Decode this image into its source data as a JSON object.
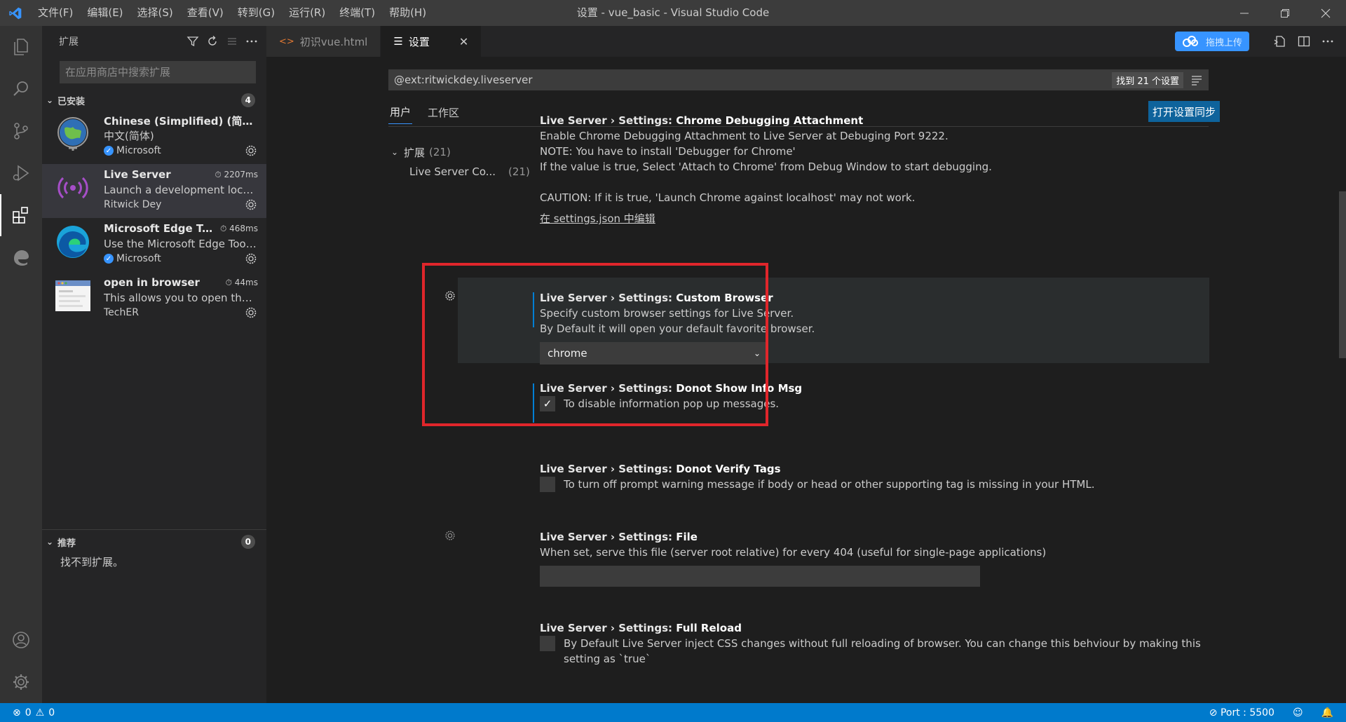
{
  "window": {
    "title": "设置 - vue_basic - Visual Studio Code",
    "menu": [
      "文件(F)",
      "编辑(E)",
      "选择(S)",
      "查看(V)",
      "转到(G)",
      "运行(R)",
      "终端(T)",
      "帮助(H)"
    ]
  },
  "sidebar": {
    "title": "扩展",
    "search_placeholder": "在应用商店中搜索扩展",
    "installed": {
      "label": "已安装",
      "count": "4",
      "items": [
        {
          "name": "Chinese (Simplified) (简体...",
          "desc": "中文(简体)",
          "publisher": "Microsoft",
          "time": ""
        },
        {
          "name": "Live Server",
          "desc": "Launch a development local...",
          "publisher": "Ritwick Dey",
          "time": "2207ms"
        },
        {
          "name": "Microsoft Edge To...",
          "desc": "Use the Microsoft Edge Tool...",
          "publisher": "Microsoft",
          "time": "468ms"
        },
        {
          "name": "open in browser",
          "desc": "This allows you to open the ...",
          "publisher": "TechER",
          "time": "44ms"
        }
      ]
    },
    "recommended": {
      "label": "推荐",
      "count": "0",
      "empty": "找不到扩展。"
    }
  },
  "tabs": [
    {
      "label": "初识vue.html"
    },
    {
      "label": "设置"
    }
  ],
  "cloud_button": "拖拽上传",
  "settings": {
    "search_value": "@ext:ritwickdey.liveserver",
    "result_count": "找到 21 个设置",
    "scope_tabs": [
      "用户",
      "工作区"
    ],
    "sync_button": "打开设置同步",
    "toc": [
      {
        "label": "扩展",
        "count": "(21)"
      },
      {
        "label": "Live Server Co...",
        "count": "(21)"
      }
    ],
    "chrome_debug": {
      "category": "Live Server › Settings: ",
      "name": "Chrome Debugging Attachment",
      "desc1": "Enable Chrome Debugging Attachment to Live Server at Debuging Port 9222.",
      "desc2": "NOTE: You have to install 'Debugger for Chrome'",
      "desc3": "If the value is true, Select 'Attach to Chrome' from Debug Window to start debugging.",
      "desc4": "CAUTION: If it is true, 'Launch Chrome against localhost' may not work.",
      "link": "在 settings.json 中编辑"
    },
    "custom_browser": {
      "category": "Live Server › Settings: ",
      "name": "Custom Browser",
      "desc1": "Specify custom browser settings for Live Server.",
      "desc2": "By Default it will open your default favorite browser.",
      "value": "chrome"
    },
    "donot_show": {
      "category": "Live Server › Settings: ",
      "name": "Donot Show Info Msg",
      "desc": "To disable information pop up messages.",
      "checked": true
    },
    "donot_verify": {
      "category": "Live Server › Settings: ",
      "name": "Donot Verify Tags",
      "desc": "To turn off prompt warning message if body or head or other supporting tag is missing in your HTML.",
      "checked": false
    },
    "file": {
      "category": "Live Server › Settings: ",
      "name": "File",
      "desc": "When set, serve this file (server root relative) for every 404 (useful for single-page applications)",
      "value": ""
    },
    "full_reload": {
      "category": "Live Server › Settings: ",
      "name": "Full Reload",
      "desc1": "By Default Live Server inject CSS changes without full reloading of browser. You can change this behviour by making this",
      "desc2": "setting as `true`",
      "checked": false
    }
  },
  "statusbar": {
    "errors": "0",
    "warnings": "0",
    "port": "Port : 5500"
  },
  "colors": {
    "accent": "#007acc",
    "highlight_box": "#e0262b"
  }
}
